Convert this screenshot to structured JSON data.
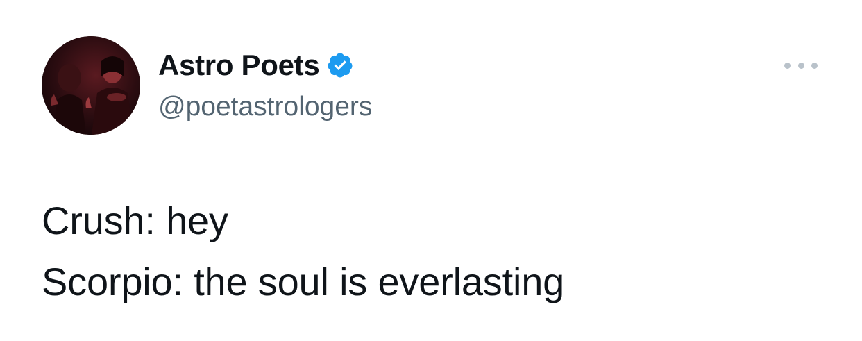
{
  "author": {
    "display_name": "Astro Poets",
    "handle": "@poetastrologers",
    "verified_icon": "verified-badge-icon",
    "verified_color": "#1d9bf0"
  },
  "menu": {
    "icon": "more-horizontal-icon"
  },
  "tweet": {
    "lines": [
      "Crush: hey",
      "Scorpio: the soul is everlasting"
    ]
  },
  "colors": {
    "text_primary": "#0f1419",
    "text_secondary": "#536471",
    "background": "#ffffff"
  }
}
